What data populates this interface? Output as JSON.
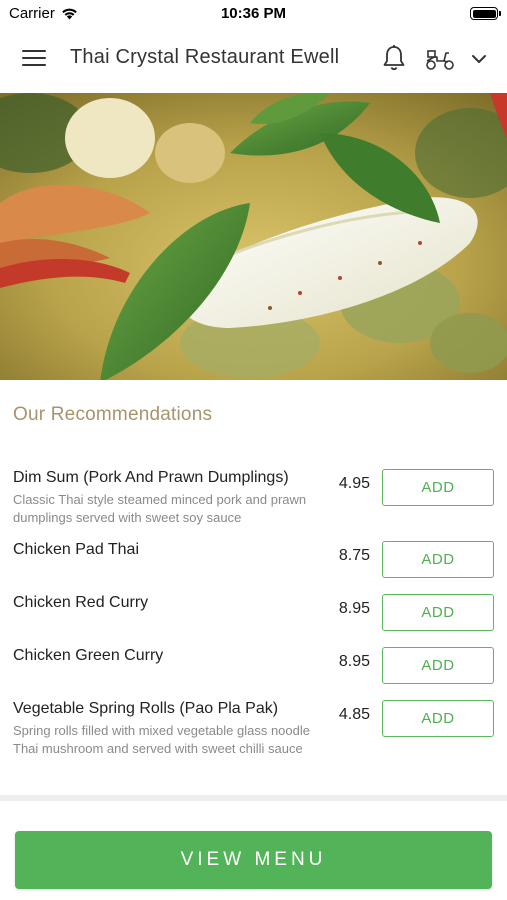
{
  "status_bar": {
    "carrier": "Carrier",
    "time": "10:36 PM",
    "wifi_icon": "wifi-icon",
    "battery_icon": "battery-icon"
  },
  "header": {
    "title": "Thai Crystal Restaurant Ewell",
    "menu_icon": "hamburger-menu-icon",
    "bell_icon": "bell-icon",
    "delivery_icon": "scooter-icon",
    "dropdown_icon": "chevron-down-icon"
  },
  "hero": {
    "image": "thai-green-curry-photo"
  },
  "recommendations": {
    "title": "Our Recommendations",
    "add_label": "ADD",
    "items": [
      {
        "name": "Dim Sum (Pork And Prawn Dumplings)",
        "description": "Classic Thai style steamed minced pork and prawn dumplings served with sweet soy sauce",
        "price": "4.95"
      },
      {
        "name": "Chicken Pad Thai",
        "description": "",
        "price": "8.75"
      },
      {
        "name": "Chicken Red Curry",
        "description": "",
        "price": "8.95"
      },
      {
        "name": "Chicken Green Curry",
        "description": "",
        "price": "8.95"
      },
      {
        "name": "Vegetable Spring Rolls (Pao Pla Pak)",
        "description": "Spring rolls filled with mixed vegetable glass noodle Thai mushroom and served with sweet chilli sauce",
        "price": "4.85"
      }
    ]
  },
  "footer": {
    "view_menu_label": "VIEW MENU"
  },
  "colors": {
    "accent_green": "#52b359",
    "section_title": "#a8946c",
    "description_gray": "#8a8a8a"
  }
}
